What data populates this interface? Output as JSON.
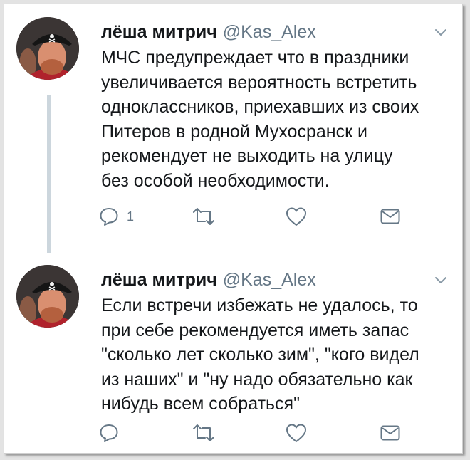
{
  "tweets": [
    {
      "name": "лёша митрич",
      "handle": "@Kas_Alex",
      "text": "МЧС предупреждает что в праздники\nувеличивается вероятность встретить\nодноклассников, приехавших из своих\nПитеров в родной Мухосранск и\nрекомендует не выходить на улицу\nбез особой необходимости.",
      "reply_count": "1"
    },
    {
      "name": "лёша митрич",
      "handle": "@Kas_Alex",
      "text": "Если встречи избежать не удалось, то\nпри себе рекомендуется иметь запас\n\"сколько лет сколько зим\", \"кого видел\nиз наших\" и \"ну надо обязательно как\nнибудь всем собраться\"",
      "reply_count": ""
    }
  ],
  "icons": {
    "reply": "reply-icon",
    "retweet": "retweet-icon",
    "like": "heart-icon",
    "dm": "envelope-icon",
    "menu": "chevron-down-icon"
  },
  "colors": {
    "text": "#14171a",
    "secondary": "#657786",
    "thread_line": "#ccd6dd"
  }
}
